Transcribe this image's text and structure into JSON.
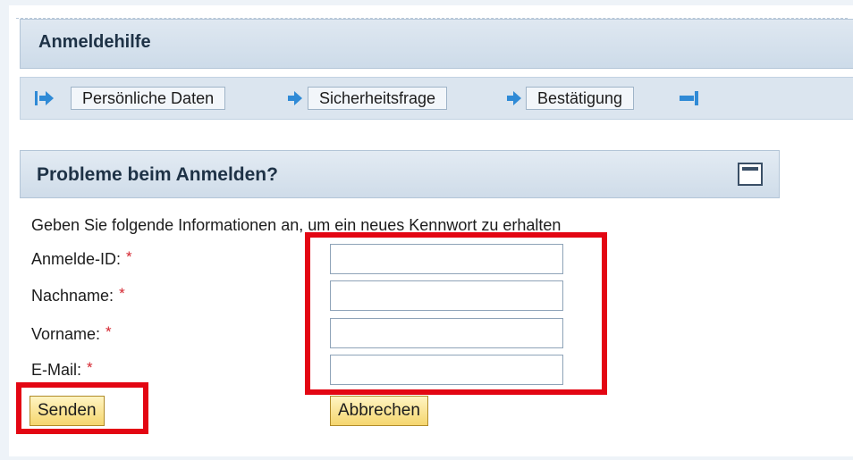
{
  "header": {
    "title": "Anmeldehilfe"
  },
  "roadmap": {
    "steps": [
      {
        "label": "Persönliche Daten"
      },
      {
        "label": "Sicherheitsfrage"
      },
      {
        "label": "Bestätigung"
      }
    ]
  },
  "panel": {
    "title": "Probleme beim Anmelden?",
    "instruction": "Geben Sie folgende Informationen an, um ein neues Kennwort zu erhalten"
  },
  "form": {
    "required_marker": "*",
    "fields": [
      {
        "label": "Anmelde-ID:",
        "value": ""
      },
      {
        "label": "Nachname:",
        "value": ""
      },
      {
        "label": "Vorname:",
        "value": ""
      },
      {
        "label": "E-Mail:",
        "value": ""
      }
    ]
  },
  "buttons": {
    "send": "Senden",
    "cancel": "Abbrechen"
  },
  "colors": {
    "highlight": "#e30613",
    "accent": "#2f8ad6",
    "required": "#d4252f"
  }
}
